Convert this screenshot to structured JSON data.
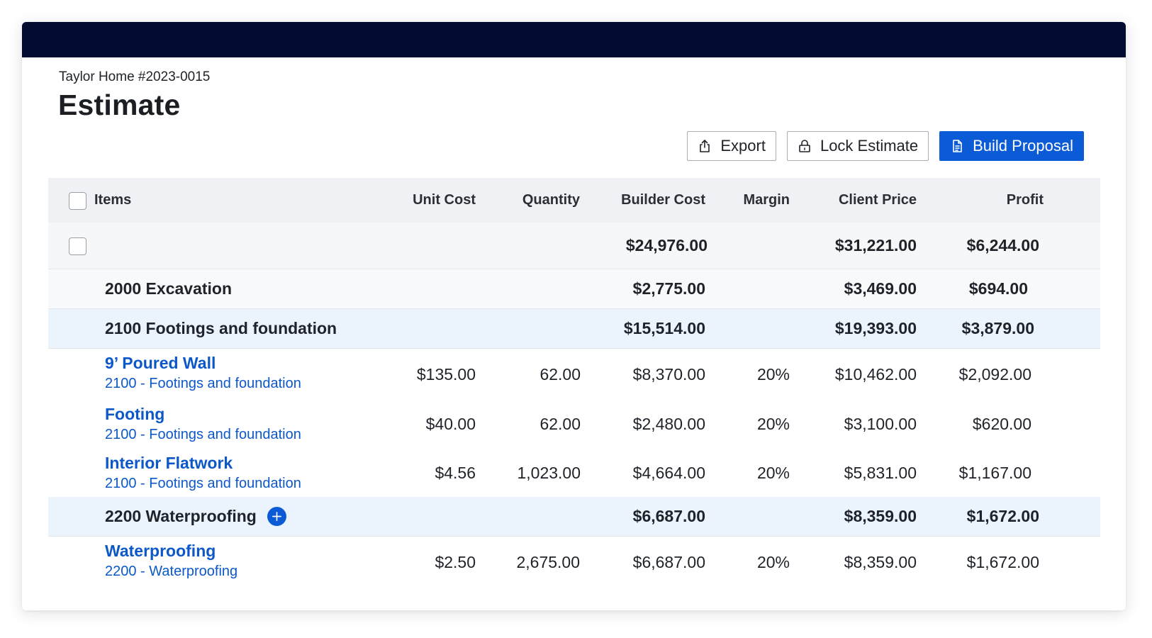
{
  "header": {
    "project": "Taylor Home #2023-0015",
    "title": "Estimate"
  },
  "actions": {
    "export_label": "Export",
    "lock_label": "Lock Estimate",
    "build_label": "Build Proposal"
  },
  "columns": {
    "items": "Items",
    "unit_cost": "Unit Cost",
    "quantity": "Quantity",
    "builder_cost": "Builder Cost",
    "margin": "Margin",
    "client_price": "Client Price",
    "profit": "Profit"
  },
  "totals": {
    "builder_cost": "$24,976.00",
    "client_price": "$31,221.00",
    "profit": "$6,244.00"
  },
  "groups": [
    {
      "label": "2000 Excavation",
      "builder_cost": "$2,775.00",
      "client_price": "$3,469.00",
      "profit": "$694.00",
      "items": []
    },
    {
      "label": "2100 Footings and foundation",
      "builder_cost": "$15,514.00",
      "client_price": "$19,393.00",
      "profit": "$3,879.00",
      "items": [
        {
          "name": "9’ Poured Wall",
          "category": "2100 - Footings and foundation",
          "unit_cost": "$135.00",
          "quantity": "62.00",
          "builder_cost": "$8,370.00",
          "margin": "20%",
          "client_price": "$10,462.00",
          "profit": "$2,092.00"
        },
        {
          "name": "Footing",
          "category": "2100 - Footings and foundation",
          "unit_cost": "$40.00",
          "quantity": "62.00",
          "builder_cost": "$2,480.00",
          "margin": "20%",
          "client_price": "$3,100.00",
          "profit": "$620.00"
        },
        {
          "name": "Interior Flatwork",
          "category": "2100 - Footings and foundation",
          "unit_cost": "$4.56",
          "quantity": "1,023.00",
          "builder_cost": "$4,664.00",
          "margin": "20%",
          "client_price": "$5,831.00",
          "profit": "$1,167.00"
        }
      ]
    },
    {
      "label": "2200 Waterproofing",
      "builder_cost": "$6,687.00",
      "client_price": "$8,359.00",
      "profit": "$1,672.00",
      "items": [
        {
          "name": "Waterproofing",
          "category": "2200 - Waterproofing",
          "unit_cost": "$2.50",
          "quantity": "2,675.00",
          "builder_cost": "$6,687.00",
          "margin": "20%",
          "client_price": "$8,359.00",
          "profit": "$1,672.00"
        }
      ]
    }
  ],
  "icons": {
    "export": "export-icon",
    "lock": "lock-icon",
    "build": "document-icon",
    "add": "plus-icon"
  },
  "colors": {
    "topbar": "#040b30",
    "primary": "#0b5bd7",
    "link": "#0c58c9",
    "group_highlight": "#ebf4fc"
  }
}
